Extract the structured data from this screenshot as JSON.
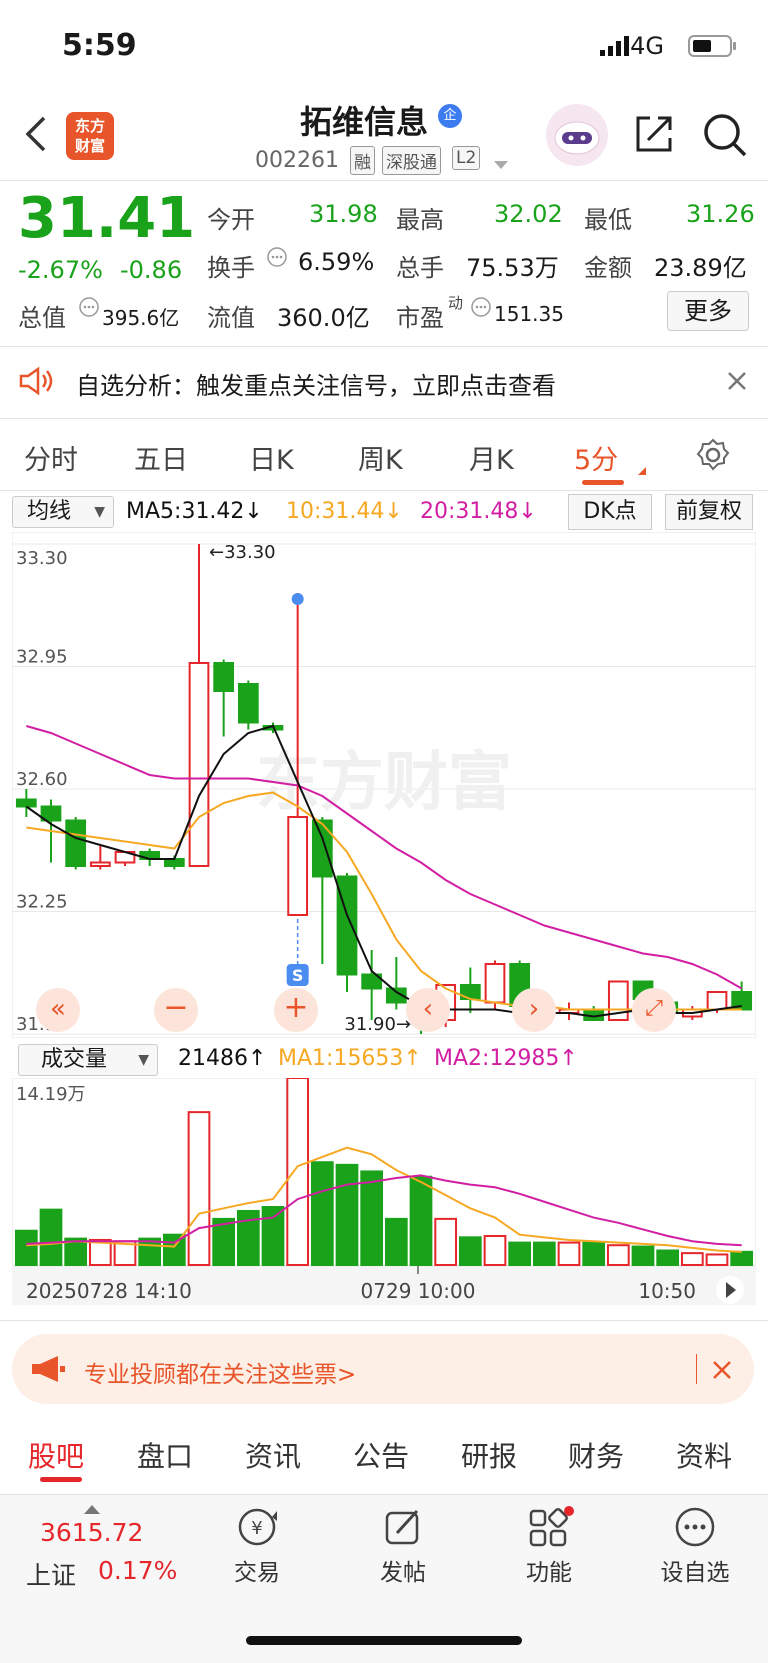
{
  "status": {
    "time": "5:59",
    "network": "4G"
  },
  "header": {
    "brand": "东方\n财富",
    "stock_name": "拓维信息",
    "corp_badge": "企",
    "stock_code": "002261",
    "tags": [
      "融",
      "深股通",
      "L2"
    ]
  },
  "quote": {
    "price": "31.41",
    "change_pct": "-2.67%",
    "change_amt": "-0.86",
    "open_label": "今开",
    "open": "31.98",
    "high_label": "最高",
    "high": "32.02",
    "low_label": "最低",
    "low": "31.26",
    "turnover_label": "换手",
    "turnover": "6.59%",
    "volume_label": "总手",
    "volume": "75.53万",
    "amount_label": "金额",
    "amount": "23.89亿",
    "mktcap_label": "总值",
    "mktcap": "395.6亿",
    "float_label": "流值",
    "float": "360.0亿",
    "pe_label": "市盈",
    "pe_sup": "动",
    "pe": "151.35",
    "more_label": "更多"
  },
  "alert": {
    "text": "自选分析：触发重点关注信号，立即点击查看"
  },
  "period_tabs": [
    "分时",
    "五日",
    "日K",
    "周K",
    "月K",
    "5分"
  ],
  "indicators": {
    "ma_select": "均线",
    "ma5": "MA5:31.42↓",
    "ma10": "10:31.44↓",
    "ma20": "20:31.48↓",
    "dk_label": "DK点",
    "fq_label": "前复权"
  },
  "colors": {
    "up": "#e5262b",
    "down": "#1aa31a",
    "ma5": "#111111",
    "ma10": "#f7a823",
    "ma20": "#d21ea3",
    "accent": "#e8552a"
  },
  "chart_data": [
    {
      "type": "candlestick",
      "y_ticks": [
        "33.30",
        "32.95",
        "32.60",
        "32.25",
        "31.90"
      ],
      "ylim": [
        31.9,
        33.3
      ],
      "annotations": {
        "max": "←33.30",
        "min": "31.90→",
        "signal": "S"
      },
      "watermark": "东方财富",
      "candles": [
        {
          "o": 32.57,
          "c": 32.55,
          "h": 32.6,
          "l": 32.52
        },
        {
          "o": 32.55,
          "c": 32.51,
          "h": 32.57,
          "l": 32.39
        },
        {
          "o": 32.51,
          "c": 32.38,
          "h": 32.52,
          "l": 32.37
        },
        {
          "o": 32.38,
          "c": 32.39,
          "h": 32.44,
          "l": 32.37
        },
        {
          "o": 32.39,
          "c": 32.42,
          "h": 32.42,
          "l": 32.38
        },
        {
          "o": 32.42,
          "c": 32.4,
          "h": 32.43,
          "l": 32.38
        },
        {
          "o": 32.4,
          "c": 32.38,
          "h": 32.41,
          "l": 32.37
        },
        {
          "o": 32.38,
          "c": 32.96,
          "h": 33.3,
          "l": 32.38
        },
        {
          "o": 32.96,
          "c": 32.88,
          "h": 32.97,
          "l": 32.75
        },
        {
          "o": 32.9,
          "c": 32.79,
          "h": 32.91,
          "l": 32.77
        },
        {
          "o": 32.78,
          "c": 32.77,
          "h": 32.79,
          "l": 32.76
        },
        {
          "o": 32.24,
          "c": 32.52,
          "h": 33.16,
          "l": 32.24
        },
        {
          "o": 32.51,
          "c": 32.35,
          "h": 32.52,
          "l": 32.1
        },
        {
          "o": 32.35,
          "c": 32.07,
          "h": 32.36,
          "l": 32.02
        },
        {
          "o": 32.07,
          "c": 32.03,
          "h": 32.14,
          "l": 31.94
        },
        {
          "o": 32.03,
          "c": 31.99,
          "h": 32.12,
          "l": 31.97
        },
        {
          "o": 31.99,
          "c": 31.93,
          "h": 31.99,
          "l": 31.9
        },
        {
          "o": 31.94,
          "c": 32.04,
          "h": 32.04,
          "l": 31.92
        },
        {
          "o": 32.04,
          "c": 32.0,
          "h": 32.09,
          "l": 31.96
        },
        {
          "o": 31.99,
          "c": 32.1,
          "h": 32.11,
          "l": 31.97
        },
        {
          "o": 32.1,
          "c": 31.98,
          "h": 32.11,
          "l": 31.97
        },
        {
          "o": 31.98,
          "c": 31.95,
          "h": 31.98,
          "l": 31.93
        },
        {
          "o": 31.96,
          "c": 31.97,
          "h": 31.99,
          "l": 31.94
        },
        {
          "o": 31.97,
          "c": 31.94,
          "h": 31.98,
          "l": 31.94
        },
        {
          "o": 31.94,
          "c": 32.05,
          "h": 32.05,
          "l": 31.94
        },
        {
          "o": 32.05,
          "c": 32.0,
          "h": 32.05,
          "l": 31.98
        },
        {
          "o": 31.99,
          "c": 31.96,
          "h": 32.0,
          "l": 31.94
        },
        {
          "o": 31.95,
          "c": 31.97,
          "h": 31.98,
          "l": 31.94
        },
        {
          "o": 31.97,
          "c": 32.02,
          "h": 32.02,
          "l": 31.96
        },
        {
          "o": 32.02,
          "c": 31.97,
          "h": 32.05,
          "l": 31.97
        }
      ],
      "ma5": [
        32.55,
        32.5,
        32.46,
        32.44,
        32.42,
        32.4,
        32.4,
        32.58,
        32.7,
        32.76,
        32.78,
        32.62,
        32.46,
        32.24,
        32.08,
        32.02,
        31.98,
        31.97,
        31.97,
        31.97,
        31.96,
        31.96,
        31.96,
        31.95,
        31.96,
        31.97,
        31.96,
        31.96,
        31.97,
        31.98
      ],
      "ma10": [
        32.49,
        32.48,
        32.47,
        32.46,
        32.45,
        32.44,
        32.43,
        32.52,
        32.56,
        32.58,
        32.59,
        32.55,
        32.5,
        32.42,
        32.3,
        32.17,
        32.08,
        32.03,
        32.0,
        31.99,
        31.98,
        31.98,
        31.97,
        31.97,
        31.97,
        31.97,
        31.97,
        31.97,
        31.97,
        31.97
      ],
      "ma20": [
        32.78,
        32.76,
        32.73,
        32.7,
        32.67,
        32.64,
        32.63,
        32.63,
        32.63,
        32.63,
        32.62,
        32.61,
        32.58,
        32.53,
        32.48,
        32.43,
        32.39,
        32.34,
        32.3,
        32.27,
        32.24,
        32.21,
        32.19,
        32.17,
        32.15,
        32.13,
        32.12,
        32.1,
        32.07,
        32.03
      ]
    },
    {
      "type": "bar",
      "title": "成交量",
      "y_max_label": "14.19万",
      "x_labels": [
        "20250728 14:10",
        "0729 10:00",
        "10:50"
      ],
      "ylim": [
        0,
        14.19
      ],
      "volumes": [
        2.6,
        4.2,
        2.0,
        1.9,
        1.8,
        2.0,
        2.3,
        11.6,
        3.5,
        4.1,
        4.4,
        14.19,
        7.8,
        7.6,
        7.1,
        3.5,
        6.7,
        3.5,
        2.1,
        2.2,
        1.7,
        1.7,
        1.7,
        1.7,
        1.5,
        1.4,
        1.1,
        0.9,
        0.8,
        1.0
      ],
      "ma1": [
        1.5,
        1.6,
        1.8,
        1.7,
        1.6,
        1.5,
        1.4,
        3.9,
        4.3,
        4.7,
        5.0,
        7.5,
        8.2,
        8.9,
        8.4,
        7.2,
        6.3,
        5.3,
        4.3,
        3.6,
        2.3,
        2.1,
        1.9,
        1.8,
        1.7,
        1.6,
        1.5,
        1.3,
        1.1,
        1.0
      ],
      "ma2": [
        1.6,
        1.7,
        1.8,
        1.8,
        1.8,
        1.8,
        1.7,
        2.8,
        3.1,
        3.4,
        3.6,
        5.0,
        5.6,
        6.1,
        6.3,
        6.6,
        6.8,
        6.4,
        6.1,
        5.9,
        5.4,
        4.8,
        4.2,
        3.6,
        3.2,
        2.7,
        2.2,
        1.8,
        1.6,
        1.5
      ]
    }
  ],
  "volume_row": {
    "select": "成交量",
    "vol": "21486↑",
    "ma1": "MA1:15653↑",
    "ma2": "MA2:12985↑"
  },
  "ad": {
    "text": "专业投顾都在关注这些票>"
  },
  "content_tabs": [
    "股吧",
    "盘口",
    "资讯",
    "公告",
    "研报",
    "财务",
    "资料"
  ],
  "bottom_nav": {
    "index_value": "3615.72",
    "index_name": "上证",
    "index_pct": "0.17%",
    "items": [
      "交易",
      "发帖",
      "功能",
      "设自选"
    ]
  }
}
